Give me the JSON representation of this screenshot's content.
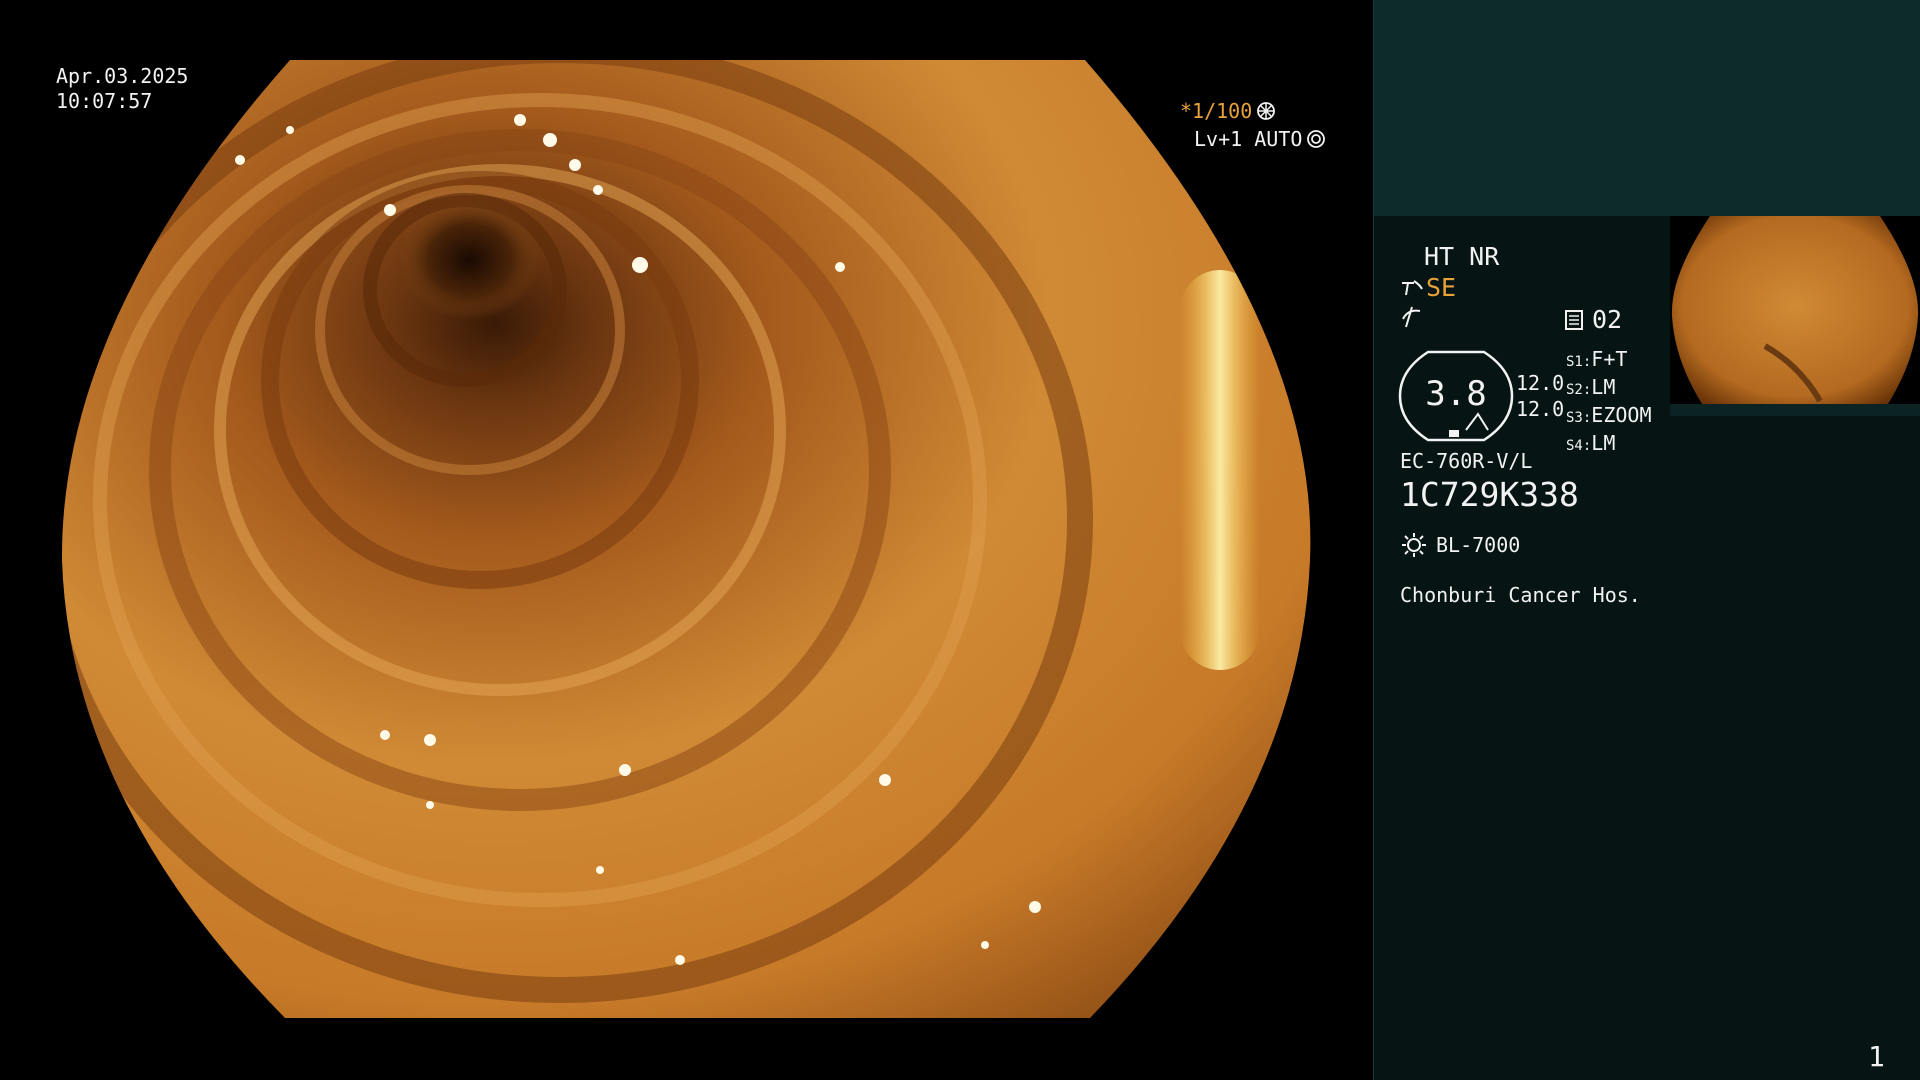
{
  "overlay": {
    "date": "Apr.03.2025",
    "time": "10:07:57",
    "shutter": "*1/100",
    "level": "Lv+1 AUTO"
  },
  "panel": {
    "mode": "HT NR",
    "se": "SE",
    "mem": "02",
    "dial_value": "3.8",
    "gain_1": "12.0",
    "gain_2": "12.0",
    "switches": [
      {
        "key": "S1:",
        "value": "F+T"
      },
      {
        "key": "S2:",
        "value": "LM"
      },
      {
        "key": "S3:",
        "value": "EZOOM"
      },
      {
        "key": "S4:",
        "value": "LM"
      }
    ],
    "scope_model": "EC-760R-V/L",
    "scope_serial": "1C729K338",
    "light_source": "BL-7000",
    "hospital": "Chonburi Cancer Hos.",
    "page_number": "1"
  },
  "colors": {
    "accent_orange": "#e8a23a",
    "panel_bg": "#061414",
    "panel_top_bg": "#0d2a2a"
  },
  "icons": [
    "shutter-icon",
    "iris-icon",
    "enhance-icon",
    "flash-icon",
    "memory-icon",
    "light-icon"
  ]
}
